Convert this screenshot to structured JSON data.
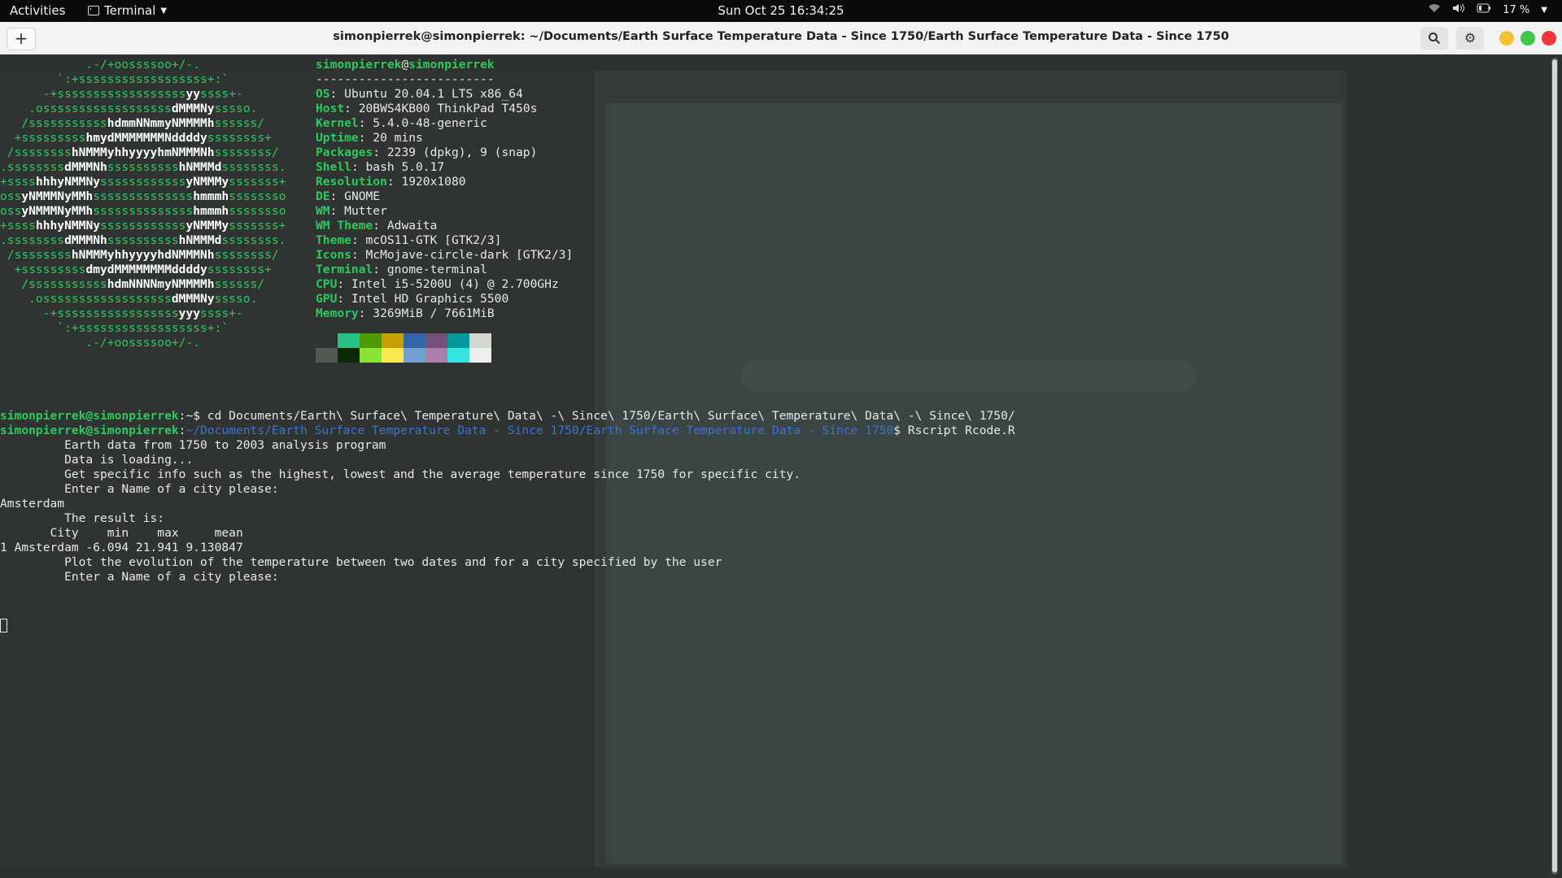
{
  "topbar": {
    "activities": "Activities",
    "app_name": "Terminal",
    "clock": "Sun Oct 25  16:34:25",
    "battery": "17 %"
  },
  "window": {
    "title": "simonpierrek@simonpierrek: ~/Documents/Earth Surface Temperature Data - Since 1750/Earth Surface Temperature Data - Since 1750",
    "new_tab": "+"
  },
  "neofetch": {
    "user": "simonpierrek",
    "at": "@",
    "host": "simonpierrek",
    "separator": "-------------------------",
    "info": [
      {
        "key": "OS",
        "value": "Ubuntu 20.04.1 LTS x86_64"
      },
      {
        "key": "Host",
        "value": "20BWS4KB00 ThinkPad T450s"
      },
      {
        "key": "Kernel",
        "value": "5.4.0-48-generic"
      },
      {
        "key": "Uptime",
        "value": "20 mins"
      },
      {
        "key": "Packages",
        "value": "2239 (dpkg), 9 (snap)"
      },
      {
        "key": "Shell",
        "value": "bash 5.0.17"
      },
      {
        "key": "Resolution",
        "value": "1920x1080"
      },
      {
        "key": "DE",
        "value": "GNOME"
      },
      {
        "key": "WM",
        "value": "Mutter"
      },
      {
        "key": "WM Theme",
        "value": "Adwaita"
      },
      {
        "key": "Theme",
        "value": "mcOS11-GTK [GTK2/3]"
      },
      {
        "key": "Icons",
        "value": "McMojave-circle-dark [GTK2/3]"
      },
      {
        "key": "Terminal",
        "value": "gnome-terminal"
      },
      {
        "key": "CPU",
        "value": "Intel i5-5200U (4) @ 2.700GHz"
      },
      {
        "key": "GPU",
        "value": "Intel HD Graphics 5500"
      },
      {
        "key": "Memory",
        "value": "3269MiB / 7661MiB"
      }
    ],
    "ascii": [
      "            .-/+oossssoo+/-.",
      "        `:+ssssssssssssssssss+:`",
      "      -+ssssssssssssssssssyyssss+-",
      "    .ossssssssssssssssssdMMMNysssso.",
      "   /ssssssssssshdmmNNmmyNMMMMhssssss/",
      "  +ssssssssshmydMMMMMMMNddddyssssssss+",
      " /sssssssshNMMMyhhyyyyhmNMMMNhssssssss/",
      ".ssssssssdMMMNhsssssssssshNMMMdssssssss.",
      "+sssshhhyNMMNyssssssssssssyNMMMysssssss+",
      "ossyNMMMNyMMhsssssssssssssshmmmhssssssso",
      "ossyNMMMNyMMhsssssssssssssshmmmhssssssso",
      "+sssshhhyNMMNyssssssssssssyNMMMysssssss+",
      ".ssssssssdMMMNhsssssssssshNMMMdssssssss.",
      " /sssssssshNMMMyhhyyyyhdNMMMNhssssssss/",
      "  +sssssssssdmydMMMMMMMMddddyssssssss+",
      "   /ssssssssssshdmNNNNmyNMMMMhssssss/",
      "    .ossssssssssssssssssdMMMNysssso.",
      "      -+sssssssssssssssssyyyssss+-",
      "        `:+ssssssssssssssssss+:`",
      "            .-/+oossssoo+/-."
    ],
    "palette": [
      "#2e3436",
      "#26c281",
      "#4e9a06",
      "#c4a000",
      "#3465a4",
      "#75507b",
      "#06989a",
      "#d3d7cf",
      "#555753",
      "#0a2a0a",
      "#8ae234",
      "#fce94f",
      "#729fcf",
      "#ad7fa8",
      "#34e2e2",
      "#eeeeec"
    ]
  },
  "session": {
    "prompt_user": "simonpierrek@simonpierrek",
    "cmd1_sep": ":~$",
    "cmd1": " cd Documents/Earth\\ Surface\\ Temperature\\ Data\\ -\\ Since\\ 1750/Earth\\ Surface\\ Temperature\\ Data\\ -\\ Since\\ 1750/",
    "colon": ":",
    "cwd": "~/Documents/Earth Surface Temperature Data - Since 1750/Earth Surface Temperature Data - Since 1750",
    "cmd2": "$ Rscript Rcode.R",
    "output": [
      "         Earth data from 1750 to 2003 analysis program",
      "         Data is loading...",
      "         Get specific info such as the highest, lowest and the average temperature since 1750 for specific city.",
      "         Enter a Name of a city please:",
      "Amsterdam",
      "         The result is:",
      "       City    min    max     mean",
      "1 Amsterdam -6.094 21.941 9.130847",
      "         Plot the evolution of the temperature between two dates and for a city specified by the user",
      "         Enter a Name of a city please:"
    ]
  }
}
